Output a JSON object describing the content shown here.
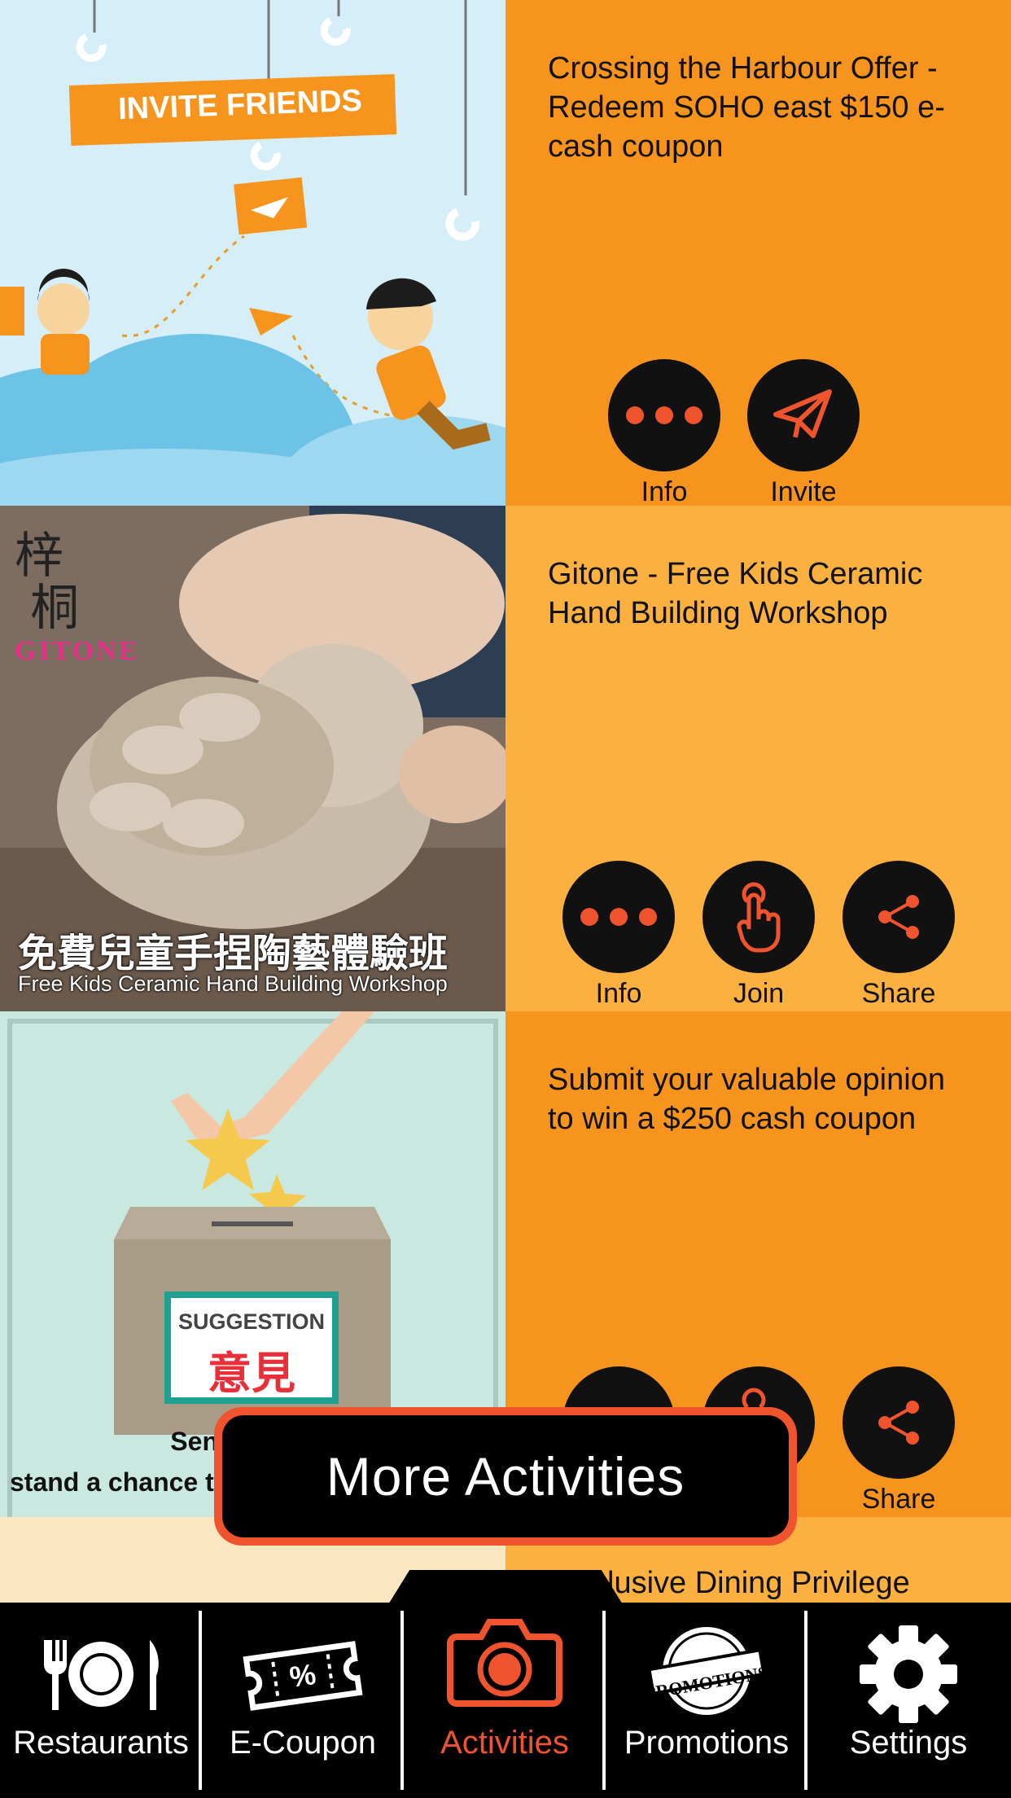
{
  "activities": [
    {
      "title": "Crossing the Harbour Offer - Redeem SOHO east $150 e-cash coupon",
      "banner_text": "INVITE FRIENDS",
      "actions": [
        {
          "label": "Info",
          "icon": "dots-icon"
        },
        {
          "label": "Invite",
          "icon": "paper-plane-icon"
        }
      ],
      "panel_color": "#f7941d"
    },
    {
      "title": "Gitone - Free Kids Ceramic Hand Building Workshop",
      "image_brand": "GITONE",
      "image_caption_zh": "免費兒童手捏陶藝體驗班",
      "image_caption_en": "Free Kids Ceramic Hand Building Workshop",
      "actions": [
        {
          "label": "Info",
          "icon": "dots-icon"
        },
        {
          "label": "Join",
          "icon": "tap-hand-icon"
        },
        {
          "label": "Share",
          "icon": "share-icon"
        }
      ],
      "panel_color": "#fbb040"
    },
    {
      "title": "Submit your valuable opinion to win a $250 cash coupon",
      "box_label_en": "SUGGESTION",
      "box_label_zh": "意見",
      "image_caption_line1": "Send us yo",
      "image_caption_line2": "stand a chance t",
      "actions": [
        {
          "label": "Share",
          "icon": "share-icon"
        }
      ],
      "panel_color": "#f7941d"
    },
    {
      "title_partial": "lusive Dining Privilege",
      "panel_color": "#fbb040"
    }
  ],
  "floating_button": {
    "label": "More Activities"
  },
  "tabbar": {
    "tabs": [
      {
        "label": "Restaurants",
        "icon": "fork-plate-knife-icon"
      },
      {
        "label": "E-Coupon",
        "icon": "coupon-icon"
      },
      {
        "label": "Activities",
        "icon": "camera-icon",
        "active": true
      },
      {
        "label": "Promotions",
        "icon": "promotions-stamp-icon"
      },
      {
        "label": "Settings",
        "icon": "gear-icon"
      }
    ],
    "promotions_stamp_text": "PROMOTIONS"
  },
  "colors": {
    "accent": "#f0542f",
    "orange_dark": "#f7941d",
    "orange_light": "#fbb040",
    "tabbar_bg": "#000000"
  }
}
